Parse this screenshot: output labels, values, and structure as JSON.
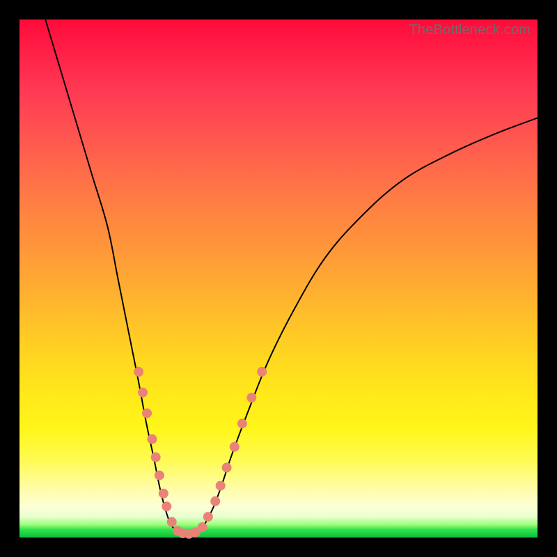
{
  "watermark": "TheBottleneck.com",
  "colors": {
    "background_frame": "#000000",
    "curve": "#000000",
    "dots": "#e98378",
    "gradient_stops": [
      "#ff0a3a",
      "#ff1f46",
      "#ff3a54",
      "#ff5a4f",
      "#ff7a44",
      "#ff963a",
      "#ffb42e",
      "#ffd022",
      "#ffe81a",
      "#fff61a",
      "#fffb52",
      "#fffca0",
      "#fdffd5",
      "#e8ffd0",
      "#9cff7a",
      "#2fe24a",
      "#0cc03c"
    ]
  },
  "chart_data": {
    "type": "line",
    "title": "",
    "xlabel": "",
    "ylabel": "",
    "xlim": [
      0,
      100
    ],
    "ylim": [
      0,
      100
    ],
    "note": "Axes are unlabeled; values are pixel-normalized 0–100. y=0 is bottom, y=100 top.",
    "series": [
      {
        "name": "v-curve",
        "points_xy": [
          [
            5,
            100
          ],
          [
            8,
            90
          ],
          [
            11,
            80
          ],
          [
            14,
            70
          ],
          [
            17,
            60
          ],
          [
            19,
            50
          ],
          [
            21,
            40
          ],
          [
            23,
            30
          ],
          [
            24.5,
            22
          ],
          [
            26,
            15
          ],
          [
            27,
            10
          ],
          [
            28,
            6
          ],
          [
            29,
            3
          ],
          [
            30,
            1.5
          ],
          [
            31,
            0.8
          ],
          [
            32,
            0.5
          ],
          [
            33,
            0.5
          ],
          [
            34,
            0.8
          ],
          [
            35,
            1.5
          ],
          [
            36,
            3
          ],
          [
            37.5,
            6
          ],
          [
            39,
            10
          ],
          [
            41,
            16
          ],
          [
            44,
            24
          ],
          [
            48,
            34
          ],
          [
            53,
            44
          ],
          [
            59,
            54
          ],
          [
            66,
            62
          ],
          [
            74,
            69
          ],
          [
            83,
            74
          ],
          [
            92,
            78
          ],
          [
            100,
            81
          ]
        ]
      }
    ],
    "markers": {
      "name": "highlight-dots",
      "radius_px": 7,
      "points_xy": [
        [
          23.0,
          32
        ],
        [
          23.8,
          28
        ],
        [
          24.6,
          24
        ],
        [
          25.6,
          19
        ],
        [
          26.3,
          15.5
        ],
        [
          27.0,
          12
        ],
        [
          27.8,
          8.5
        ],
        [
          28.4,
          6
        ],
        [
          29.4,
          3
        ],
        [
          30.5,
          1.3
        ],
        [
          31.5,
          0.8
        ],
        [
          32.7,
          0.7
        ],
        [
          34.0,
          1.0
        ],
        [
          35.3,
          2.0
        ],
        [
          36.4,
          4.0
        ],
        [
          37.8,
          7.0
        ],
        [
          38.8,
          10.0
        ],
        [
          40.0,
          13.5
        ],
        [
          41.5,
          17.5
        ],
        [
          43.0,
          22.0
        ],
        [
          44.8,
          27.0
        ],
        [
          46.8,
          32.0
        ]
      ]
    }
  }
}
